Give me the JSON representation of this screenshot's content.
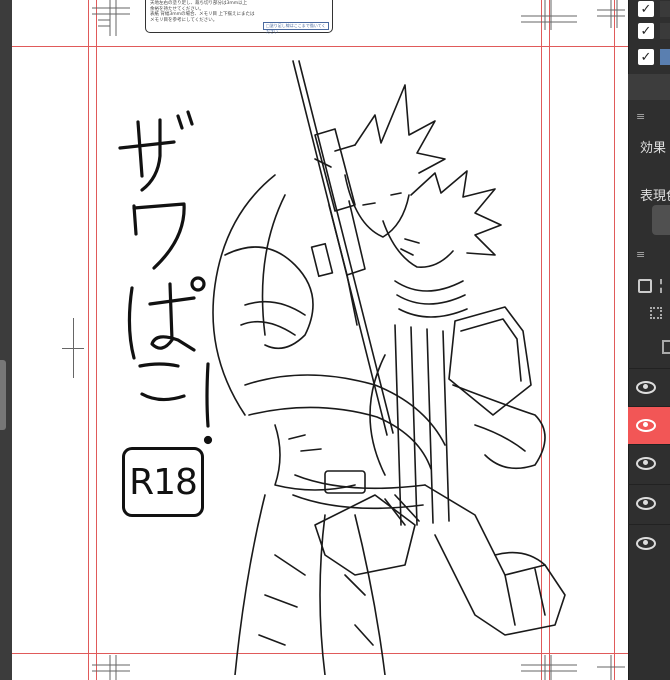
{
  "canvas": {
    "note_lines": [
      "天地左右の塗り足し、裁ち切り部分は3mm以上",
      "余裕を持たせてください。",
      "表紙 背幅3mmの場合、メモリ目 上下揃えにまたは",
      "メモリ目を参考にしてください。"
    ],
    "note_sub": "□塗り足し線はここまで描いてください"
  },
  "title_art": {
    "text": "ザワぱこ!",
    "badge": "R18"
  },
  "panel": {
    "checks": [
      "✓",
      "✓",
      "✓"
    ],
    "effect_label": "効果",
    "display_label": "表現色",
    "menu_glyph": "≡",
    "layers": [
      {
        "visible": true,
        "selected": false
      },
      {
        "visible": true,
        "selected": true
      },
      {
        "visible": true,
        "selected": false
      },
      {
        "visible": true,
        "selected": false
      },
      {
        "visible": true,
        "selected": false
      }
    ],
    "colors": {
      "selected_layer": "#f25656",
      "guide_line": "#e05a5a"
    }
  }
}
